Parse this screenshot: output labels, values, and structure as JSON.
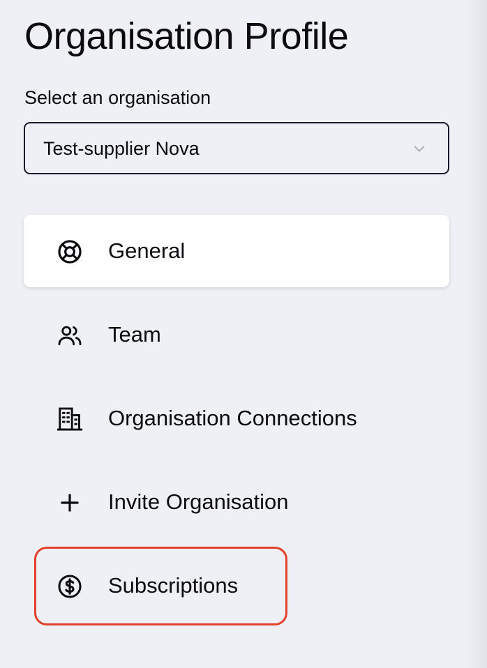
{
  "header": {
    "title": "Organisation Profile"
  },
  "org_selector": {
    "label": "Select an organisation",
    "selected": "Test-supplier Nova"
  },
  "nav": {
    "items": [
      {
        "label": "General",
        "icon": "lifebuoy-icon",
        "active": true
      },
      {
        "label": "Team",
        "icon": "users-icon",
        "active": false
      },
      {
        "label": "Organisation Connections",
        "icon": "building-icon",
        "active": false
      },
      {
        "label": "Invite Organisation",
        "icon": "plus-icon",
        "active": false
      },
      {
        "label": "Subscriptions",
        "icon": "dollar-circle-icon",
        "active": false
      }
    ]
  },
  "colors": {
    "background": "#eef0f5",
    "active_item_bg": "#ffffff",
    "highlight_border": "#e4412c",
    "text": "#0b0b0f"
  }
}
